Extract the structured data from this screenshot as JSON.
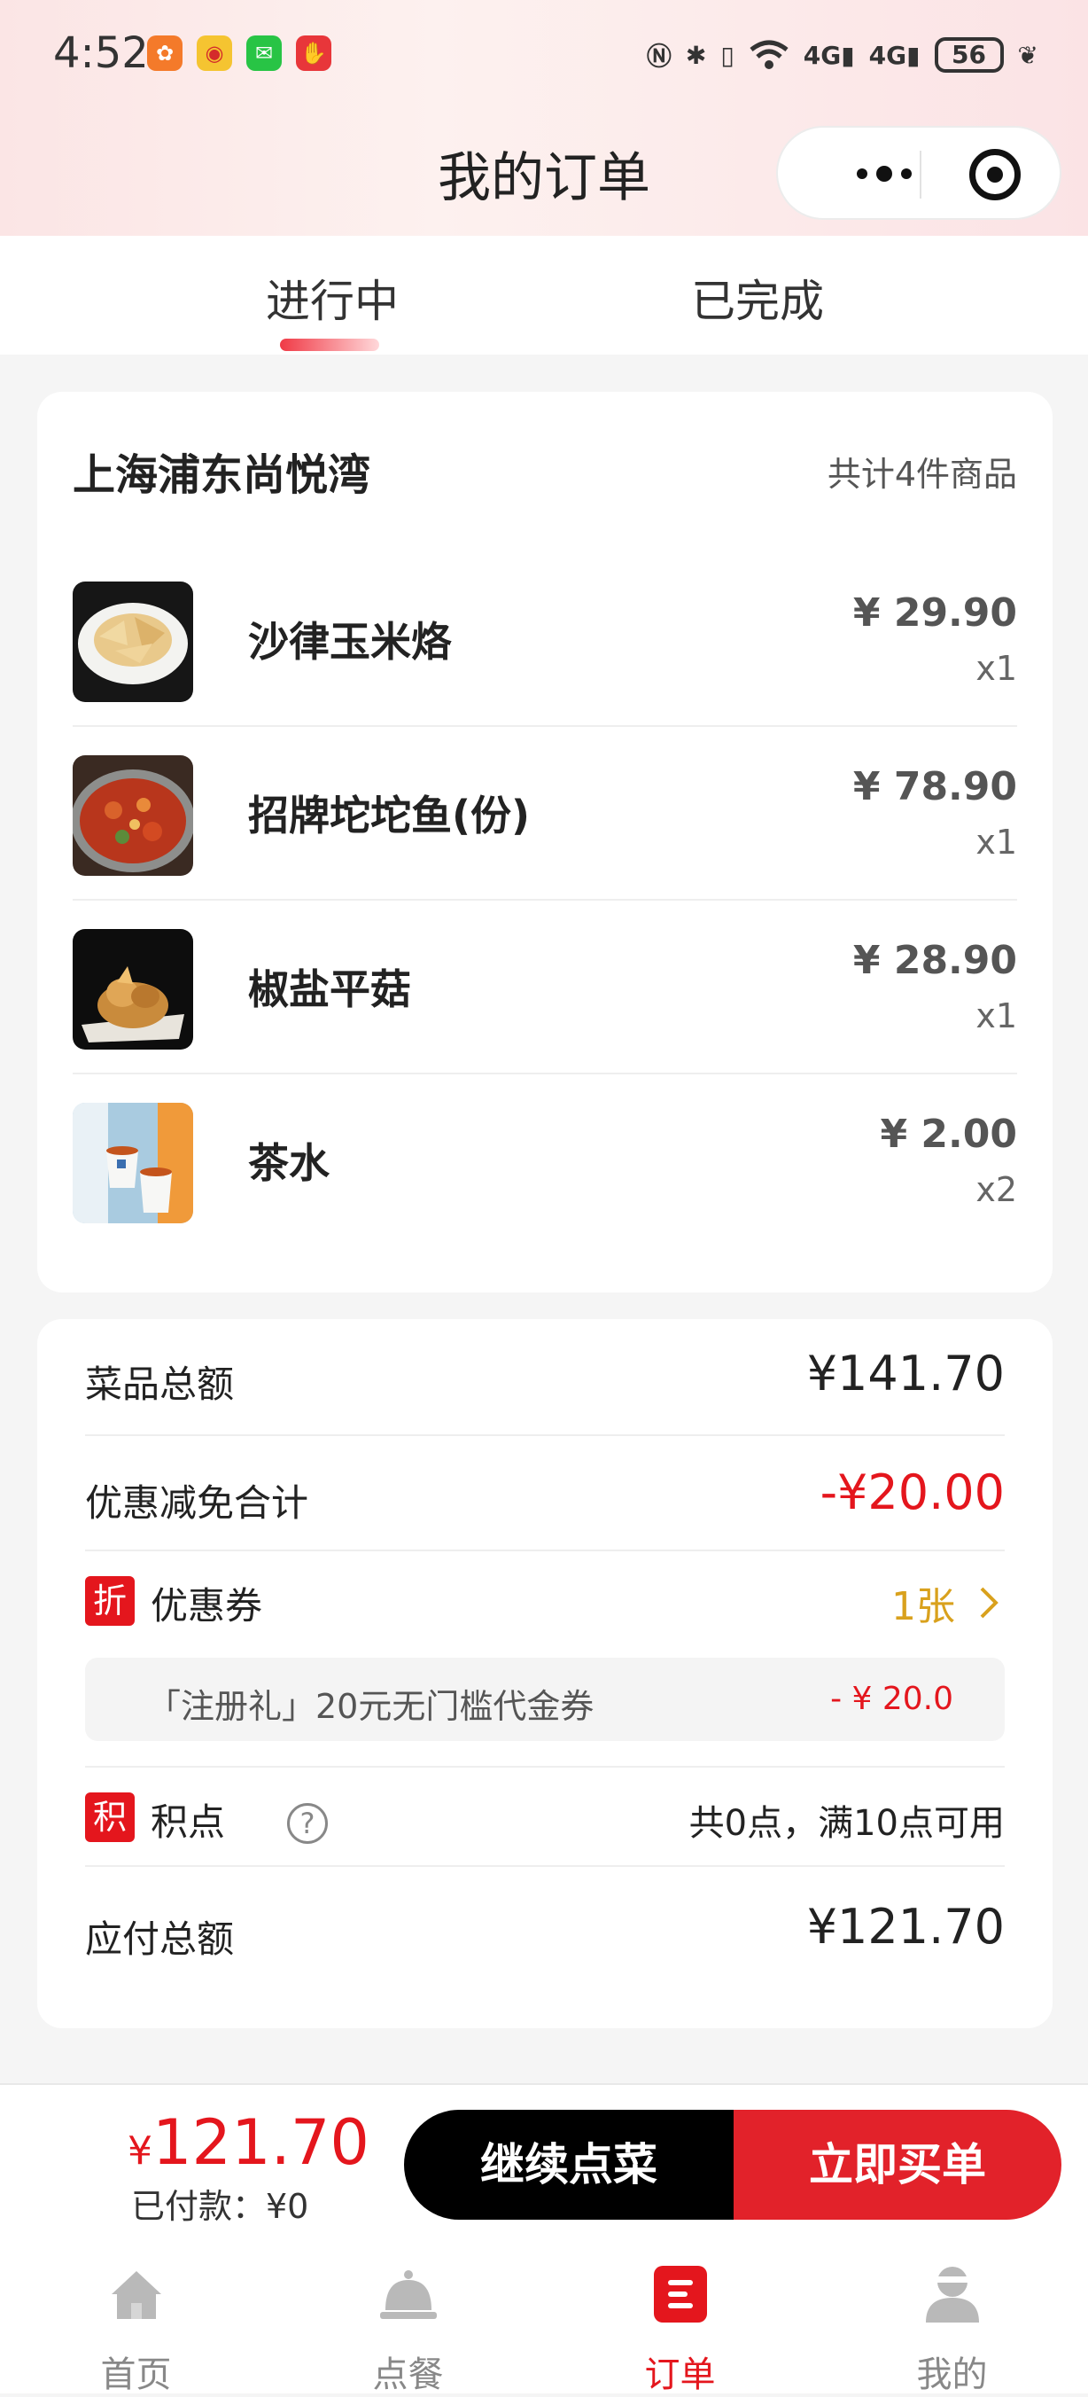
{
  "status_bar": {
    "time": "4:52",
    "network_1": "4G",
    "network_2": "4G",
    "battery": "56"
  },
  "header": {
    "title": "我的订单"
  },
  "tabs": [
    {
      "label": "进行中",
      "active": true
    },
    {
      "label": "已完成",
      "active": false
    }
  ],
  "order": {
    "store_name": "上海浦东尚悦湾",
    "item_count": "共计4件商品",
    "items": [
      {
        "name": "沙律玉米烙",
        "price": "¥ 29.90",
        "qty": "x1"
      },
      {
        "name": "招牌坨坨鱼(份)",
        "price": "¥ 78.90",
        "qty": "x1"
      },
      {
        "name": "椒盐平菇",
        "price": "¥ 28.90",
        "qty": "x1"
      },
      {
        "name": "茶水",
        "price": "¥ 2.00",
        "qty": "x2"
      }
    ]
  },
  "summary": {
    "dish_total_label": "菜品总额",
    "dish_total_value": "¥141.70",
    "discount_label": "优惠减免合计",
    "discount_value": "-¥20.00",
    "coupon_tag": "折",
    "coupon_label": "优惠券",
    "coupon_count": "1张",
    "coupon_name": "「注册礼」20元无门槛代金券",
    "coupon_amount": "- ¥ 20.0",
    "points_tag": "积",
    "points_label": "积点",
    "points_info": "共0点，满10点可用",
    "payable_label": "应付总额",
    "payable_value": "¥121.70"
  },
  "action_bar": {
    "currency": "¥",
    "amount": "121.70",
    "paid_text": "已付款：¥0",
    "continue_label": "继续点菜",
    "pay_label": "立即买单"
  },
  "tabbar": [
    {
      "label": "首页",
      "icon": "home-icon",
      "active": false
    },
    {
      "label": "点餐",
      "icon": "dining-bell-icon",
      "active": false
    },
    {
      "label": "订单",
      "icon": "order-list-icon",
      "active": true
    },
    {
      "label": "我的",
      "icon": "user-profile-icon",
      "active": false
    }
  ],
  "colors": {
    "accent_red": "#e4161d",
    "coupon_gold": "#d9a11d",
    "pay_button": "#e2222a"
  }
}
